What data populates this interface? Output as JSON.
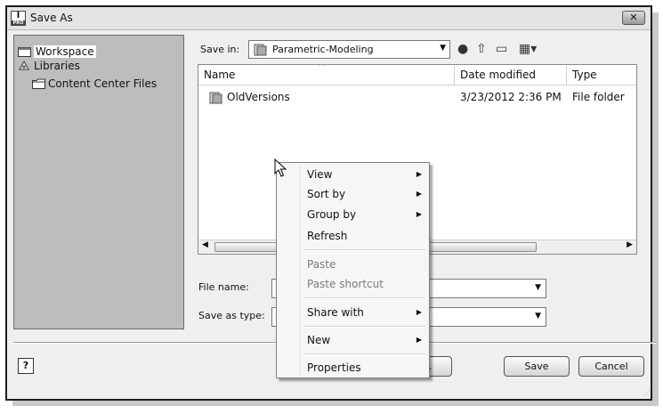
{
  "window": {
    "title": "Save As",
    "close_glyph": "✕",
    "app_icon": {
      "top": "I",
      "bottom": "PRO"
    }
  },
  "places": [
    {
      "label": "Workspace",
      "icon": "workspace-icon",
      "selected": true
    },
    {
      "label": "Libraries",
      "icon": "libraries-icon",
      "selected": false
    },
    {
      "label": "Content Center Files",
      "icon": "folder-icon",
      "selected": false
    }
  ],
  "save_in": {
    "label": "Save in:",
    "value": "Parametric-Modeling"
  },
  "toolbar": {
    "back_icon": "back-icon",
    "up_icon": "up-folder-icon",
    "new_folder_icon": "new-folder-icon",
    "view_icon": "view-menu-icon"
  },
  "list": {
    "columns": [
      "Name",
      "Date modified",
      "Type"
    ],
    "sort_glyph": "^",
    "rows": [
      {
        "name": "OldVersions",
        "date": "3/23/2012 2:36 PM",
        "type": "File folder"
      }
    ]
  },
  "file_name": {
    "label": "File name:",
    "value": ""
  },
  "save_as_type": {
    "label": "Save as type:",
    "value": ""
  },
  "buttons": {
    "options": "...",
    "save": "Save",
    "cancel": "Cancel",
    "help_glyph": "?"
  },
  "context_menu": {
    "items": [
      {
        "label": "View",
        "submenu": true,
        "disabled": false
      },
      {
        "label": "Sort by",
        "submenu": true,
        "disabled": false
      },
      {
        "label": "Group by",
        "submenu": true,
        "disabled": false
      },
      {
        "label": "Refresh",
        "submenu": false,
        "disabled": false
      },
      {
        "label": "Paste",
        "submenu": false,
        "disabled": true
      },
      {
        "label": "Paste shortcut",
        "submenu": false,
        "disabled": true
      },
      {
        "label": "Share with",
        "submenu": true,
        "disabled": false
      },
      {
        "label": "New",
        "submenu": true,
        "disabled": false
      },
      {
        "label": "Properties",
        "submenu": false,
        "disabled": false
      }
    ]
  }
}
